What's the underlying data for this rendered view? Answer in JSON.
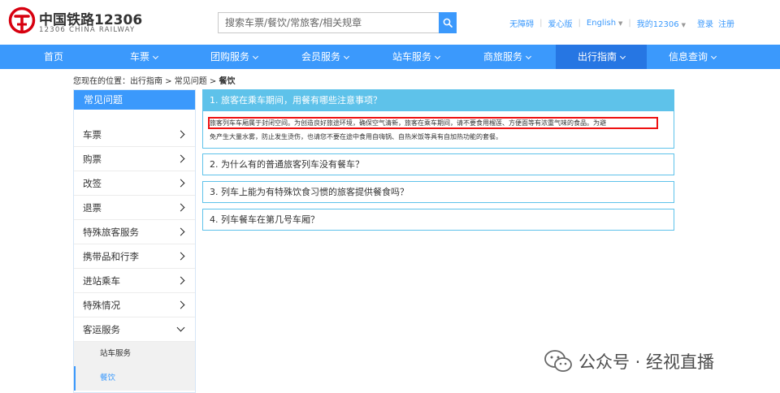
{
  "header": {
    "logo_cn": "中国铁路12306",
    "logo_en": "12306 CHINA RAILWAY",
    "search_placeholder": "搜索车票/餐饮/常旅客/相关规章",
    "links": [
      "无障碍",
      "爱心版",
      "English",
      "我的12306"
    ],
    "login": "登录",
    "register": "注册"
  },
  "nav": {
    "items": [
      {
        "label": "首页",
        "caret": false
      },
      {
        "label": "车票",
        "caret": true
      },
      {
        "label": "团购服务",
        "caret": true
      },
      {
        "label": "会员服务",
        "caret": true
      },
      {
        "label": "站车服务",
        "caret": true
      },
      {
        "label": "商旅服务",
        "caret": true
      },
      {
        "label": "出行指南",
        "caret": true,
        "active": true
      },
      {
        "label": "信息查询",
        "caret": true
      }
    ]
  },
  "breadcrumb": {
    "prefix": "您现在的位置：出行指南 > 常见问题 > ",
    "current": "餐饮"
  },
  "sidebar": {
    "title": "常见问题",
    "items": [
      "车票",
      "购票",
      "改签",
      "退票",
      "特殊旅客服务",
      "携带品和行李",
      "进站乘车",
      "特殊情况",
      "客运服务"
    ],
    "sub_items": [
      "站车服务",
      "餐饮"
    ]
  },
  "faq": {
    "open_question": "1. 旅客在乘车期间，用餐有哪些注意事项？",
    "answer_line1": "旅客列车车厢属于封闭空间。为创造良好旅途环境，确保空气清新，旅客在乘车期间，请不要食用榴莲、方便面等有浓重气味的食品。为避",
    "answer_line2": "免产生大量水雾，防止发生烫伤，也请您不要在途中食用自嗨锅、自热米饭等具有自加热功能的套餐。",
    "questions": [
      "2. 为什么有的普通旅客列车没有餐车？",
      "3. 列车上能为有特殊饮食习惯的旅客提供餐食吗？",
      "4. 列车餐车在第几号车厢？"
    ]
  },
  "watermark": {
    "text": "公众号 · 经视直播",
    "icon": "wechat-icon"
  },
  "colors": {
    "primary": "#3b99fc",
    "nav_active": "#2676e3",
    "faq_accent": "#5ec2ea",
    "logo_red": "#d7000f",
    "highlight": "#e11111"
  }
}
